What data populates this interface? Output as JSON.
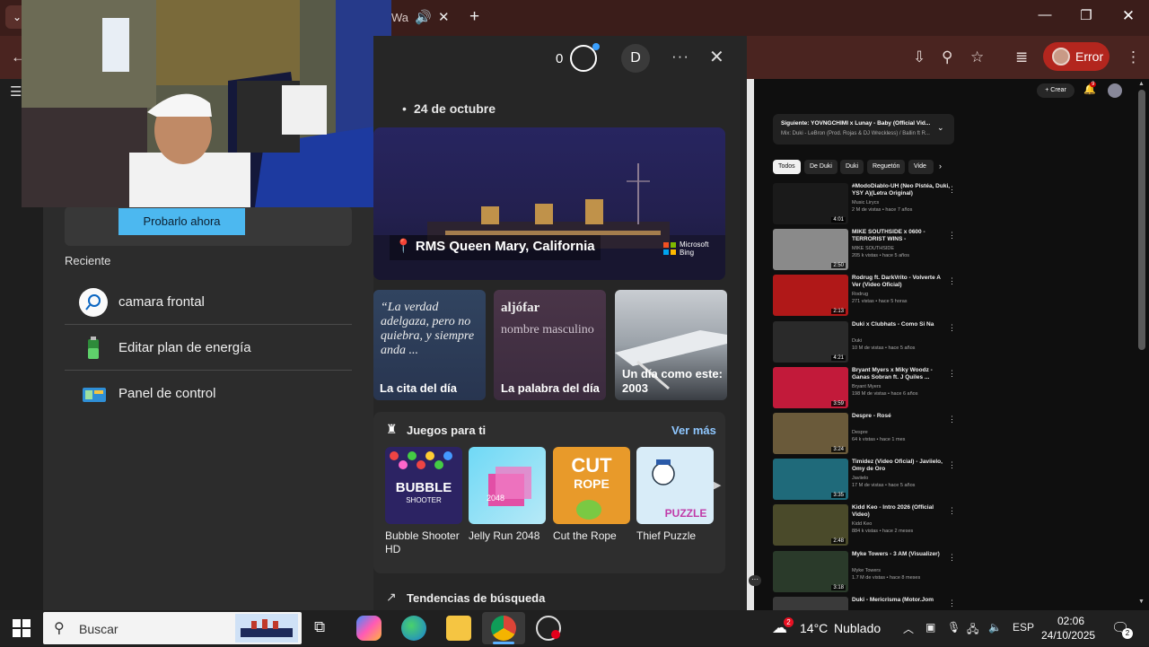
{
  "browser": {
    "tab_title": "Wa",
    "profile_label": "Error"
  },
  "start_panel": {
    "try_button": "Probarlo ahora",
    "recent_heading": "Reciente",
    "recent_items": [
      {
        "label": "camara frontal",
        "icon": "search-icon"
      },
      {
        "label": "Editar plan de energía",
        "icon": "battery-icon"
      },
      {
        "label": "Panel de control",
        "icon": "control-panel-icon"
      }
    ]
  },
  "widget": {
    "points": "0",
    "avatar_letter": "D",
    "date": "24 de octubre",
    "hero": {
      "location": "RMS Queen Mary, California",
      "brand_line1": "Microsoft",
      "brand_line2": "Bing"
    },
    "cards": [
      {
        "body": "“La verdad adelgaza, pero no quiebra, y siempre anda ...",
        "footer": "La cita del día"
      },
      {
        "title": "aljófar",
        "subtitle": "nombre masculino",
        "footer": "La palabra del día"
      },
      {
        "footer": "Un día como este: 2003"
      }
    ],
    "games": {
      "heading": "Juegos para ti",
      "more": "Ver más",
      "items": [
        {
          "name": "Bubble Shooter HD",
          "color": "#3a2d6e"
        },
        {
          "name": "Jelly Run 2048",
          "color": "#4fc2e6"
        },
        {
          "name": "Cut the Rope",
          "color": "#e89a2a"
        },
        {
          "name": "Thief Puzzle",
          "color": "#cfe6f5"
        }
      ]
    },
    "trends": "Tendencias de búsqueda"
  },
  "youtube": {
    "create": "Crear",
    "notif_count": "9",
    "now_playing_title": "Siguiente: YOVNGCHIMI x Lunay - Baby (Official Vid...",
    "now_playing_sub": "Mix: Duki - LeBron (Prod. Rojas & DJ Wreckless) / Ballin ft R...",
    "chips": [
      "Todos",
      "De Duki",
      "Duki",
      "Reguetón",
      "Vide"
    ],
    "videos": [
      {
        "title": "#ModoDiablo-UH (Neo Pistéa, Duki, YSY A)(Letra Original)",
        "channel": "Music Lirycs",
        "meta": "2 M de vistas • hace 7 años",
        "duration": "4:01",
        "color": "#1a1a1a"
      },
      {
        "title": "MIKE SOUTHSIDE x 0600 - TERRORIST WINS -",
        "channel": "MIKE SOUTHSIDE",
        "meta": "205 k vistas • hace 5 años",
        "duration": "2:50",
        "color": "#8a8a8a"
      },
      {
        "title": "Rodrug ft. DarkVrito - Volverte A Ver (Video Oficial)",
        "channel": "Rodrug",
        "meta": "271 vistas • hace 5 horas",
        "duration": "2:13",
        "color": "#b01818"
      },
      {
        "title": "Duki x Clubhats - Como Si Na",
        "channel": "Duki",
        "meta": "10 M de vistas • hace 5 años",
        "duration": "4:21",
        "color": "#2a2a2a"
      },
      {
        "title": "Bryant Myers x Miky Woodz - Ganas Sobran ft. J Quiles ...",
        "channel": "Bryant Myers",
        "meta": "198 M de vistas • hace 6 años",
        "duration": "3:59",
        "color": "#c21a3a"
      },
      {
        "title": "Despre - Rosé",
        "channel": "Despre",
        "meta": "64 k vistas • hace 1 mes",
        "duration": "3:24",
        "color": "#6a5a3a"
      },
      {
        "title": "Timidez (Video Oficial) - Javiielo, Omy de Oro",
        "channel": "Javiielo",
        "meta": "17 M de vistas • hace 5 años",
        "duration": "3:35",
        "color": "#1f6a7a"
      },
      {
        "title": "Kidd Keo - Intro 2026 (Official Video)",
        "channel": "Kidd Keo",
        "meta": "884 k vistas • hace 2 meses",
        "duration": "2:48",
        "color": "#4a4a2a"
      },
      {
        "title": "Myke Towers - 3 AM (Visualizer)",
        "channel": "Myke Towers",
        "meta": "1.7 M de vistas • hace 8 meses",
        "duration": "3:18",
        "color": "#2a3a2a"
      },
      {
        "title": "Duki - Mericrisma (Motor.Jom",
        "channel": "",
        "meta": "",
        "duration": "",
        "color": "#3a3a3a"
      }
    ]
  },
  "taskbar": {
    "search_placeholder": "Buscar",
    "weather_badge": "2",
    "temp": "14°C",
    "condition": "Nublado",
    "lang": "ESP",
    "time": "02:06",
    "date": "24/10/2025",
    "notif_count": "2"
  }
}
